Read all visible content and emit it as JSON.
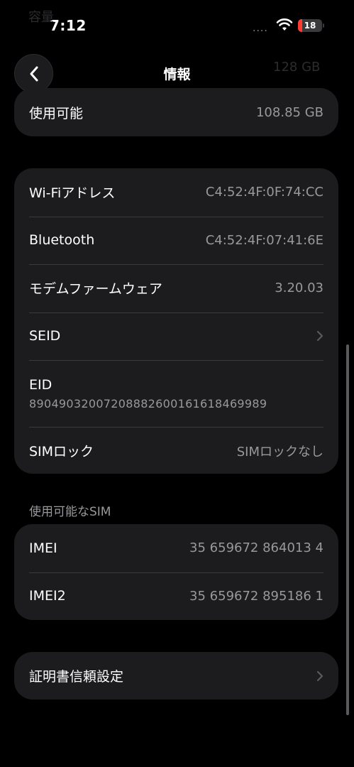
{
  "status": {
    "time": "7:12",
    "signal": "....",
    "battery": "18",
    "battery_level": 0.18
  },
  "ghost": {
    "left": "容量",
    "right": "128 GB"
  },
  "nav": {
    "title": "情報"
  },
  "storage": {
    "label": "使用可能",
    "value": "108.85 GB"
  },
  "network": {
    "wifi_label": "Wi-Fiアドレス",
    "wifi_value": "C4:52:4F:0F:74:CC",
    "bt_label": "Bluetooth",
    "bt_value": "C4:52:4F:07:41:6E",
    "modem_label": "モデムファームウェア",
    "modem_value": "3.20.03",
    "seid_label": "SEID",
    "eid_label": "EID",
    "eid_value": "89049032007208882600161618469989",
    "simlock_label": "SIMロック",
    "simlock_value": "SIMロックなし"
  },
  "sim_section": {
    "header": "使用可能なSIM",
    "imei_label": "IMEI",
    "imei_value": "35 659672 864013 4",
    "imei2_label": "IMEI2",
    "imei2_value": "35 659672 895186 1"
  },
  "cert": {
    "label": "証明書信頼設定"
  },
  "icons": {
    "back": "chevron-left-icon",
    "chevron": "chevron-right-icon",
    "wifi": "wifi-icon",
    "battery": "battery-icon"
  }
}
